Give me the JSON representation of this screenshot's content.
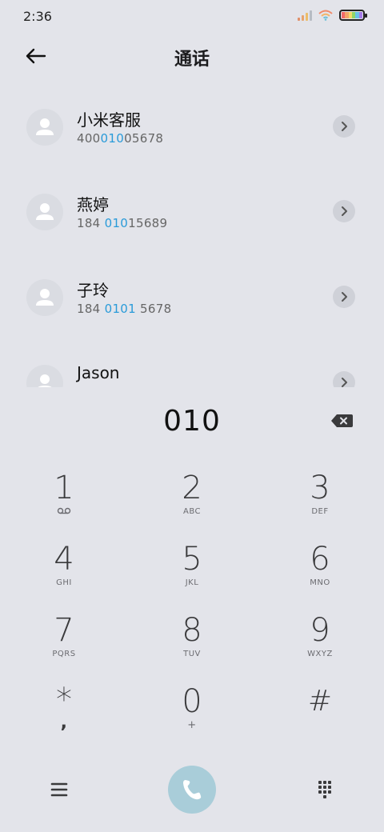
{
  "status_bar": {
    "time": "2:36"
  },
  "header": {
    "title": "通话"
  },
  "contacts": [
    {
      "name": "小米客服",
      "number_pre": "400",
      "number_match": "010",
      "number_post": "05678"
    },
    {
      "name": "燕婷",
      "number_pre": "184 ",
      "number_match": "010",
      "number_post": "15689"
    },
    {
      "name": "子玲",
      "number_pre": "184 ",
      "number_match": "0101",
      "number_post": " 5678"
    },
    {
      "name": "Jason",
      "number_pre": "",
      "number_match": "",
      "number_post": ""
    }
  ],
  "dialer": {
    "input_value": "010"
  },
  "keypad": [
    {
      "digit": "1",
      "letters": ""
    },
    {
      "digit": "2",
      "letters": "ABC"
    },
    {
      "digit": "3",
      "letters": "DEF"
    },
    {
      "digit": "4",
      "letters": "GHI"
    },
    {
      "digit": "5",
      "letters": "JKL"
    },
    {
      "digit": "6",
      "letters": "MNO"
    },
    {
      "digit": "7",
      "letters": "PQRS"
    },
    {
      "digit": "8",
      "letters": "TUV"
    },
    {
      "digit": "9",
      "letters": "WXYZ"
    },
    {
      "digit": "*",
      "letters": ","
    },
    {
      "digit": "0",
      "letters": "+"
    },
    {
      "digit": "#",
      "letters": ""
    }
  ],
  "icons": {
    "back": "arrow-left-icon",
    "backspace": "backspace-icon",
    "voicemail": "voicemail-icon",
    "menu": "menu-icon",
    "call": "phone-icon",
    "dialpad": "dialpad-icon"
  },
  "colors": {
    "background": "#E3E4EA",
    "match_highlight": "#2a9bd9",
    "call_button": "#A9CDD9"
  }
}
